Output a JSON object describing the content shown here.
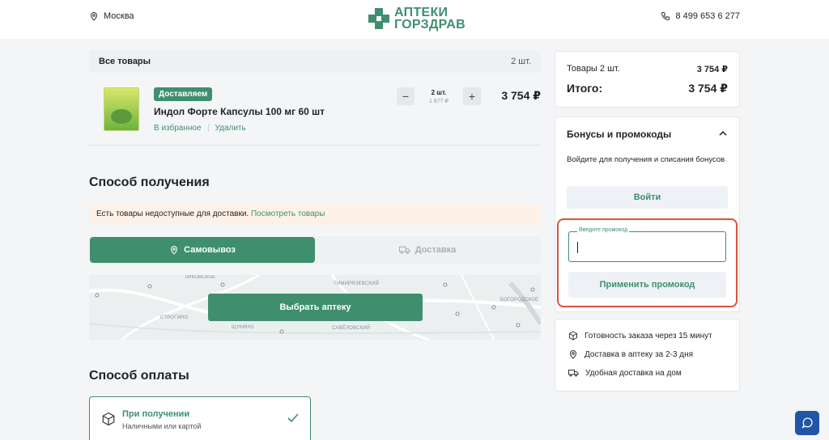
{
  "header": {
    "city": "Москва",
    "logo_line1": "АПТЕКИ",
    "logo_line2": "ГОРЗДРАВ",
    "phone": "8 499 653 6 277",
    "accent_color": "#3f8f6e"
  },
  "cart": {
    "title": "Все товары",
    "count": "2 шт.",
    "item": {
      "badge": "Доставляем",
      "name": "Индол Форте Капсулы 100 мг 60 шт",
      "favorite_link": "В избранное",
      "delete_link": "Удалить",
      "qty": "2 шт.",
      "unit_price": "1 877 ₽",
      "total": "3 754 ₽",
      "minus": "−",
      "plus": "+"
    }
  },
  "delivery": {
    "title": "Способ получения",
    "notice": "Есть товары недоступные для доставки.",
    "notice_link": "Посмотреть товары",
    "pickup_label": "Самовывоз",
    "courier_label": "Доставка",
    "map_labels": [
      "ТИМИРЯЗЕВСКИЙ",
      "СТРОГИНО",
      "ЩУКИНО",
      "САВЁЛОВСКИЙ",
      "БОГОРОДСКОЕ",
      "ЛИКОВСКОЕ"
    ],
    "choose_pharmacy": "Выбрать аптеку"
  },
  "payment": {
    "title": "Способ оплаты",
    "option_title": "При получении",
    "option_sub": "Наличными или картой"
  },
  "summary": {
    "items_label": "Товары 2 шт.",
    "items_value": "3 754 ₽",
    "total_label": "Итого:",
    "total_value": "3 754 ₽"
  },
  "bonus": {
    "title": "Бонусы и промокоды",
    "desc": "Войдите для получения и списания бонусов",
    "login_button": "Войти",
    "promo_placeholder": "Введите промокод",
    "apply_button": "Применить промокод",
    "highlight_color": "#d9533c"
  },
  "info": {
    "ready": "Готовность заказа через 15 минут",
    "pharmacy_delivery": "Доставка в аптеку за 2-3 дня",
    "home_delivery": "Удобная доставка на дом"
  },
  "icons": [
    "location-pin-icon",
    "phone-icon",
    "truck-icon",
    "box-icon",
    "check-icon",
    "chevron-up-icon",
    "chat-icon"
  ]
}
